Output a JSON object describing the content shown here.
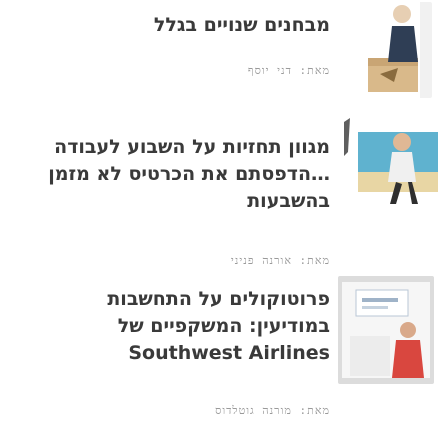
{
  "section": {
    "title": "מבחנים שנויים בגלל"
  },
  "articles": [
    {
      "headline_lines": [
        "מבחנים שנויים בגלל"
      ],
      "byline": "מאת: דני יוסף",
      "thumb_icon": "box-with-arrow-icon"
    },
    {
      "headline_lines": [
        "מגוון תחזיות על השבוע לעבודה",
        "…הדפסתם את הכרטיס לא מזמן",
        "בהשבעות"
      ],
      "byline": "מאת: אורנה פניני",
      "thumb_icon": "person-on-beach-icon"
    },
    {
      "headline_lines": [
        "פרוטוקולים על התחשבות",
        "במודיעין: המשקפיים של",
        "Southwest Airlines"
      ],
      "byline": "מאת: מורנה גוטלדוס",
      "thumb_icon": "presenter-slide-icon"
    }
  ],
  "colors": {
    "text": "#3a3a3a",
    "muted": "#9a9a9a",
    "background": "#ffffff"
  }
}
